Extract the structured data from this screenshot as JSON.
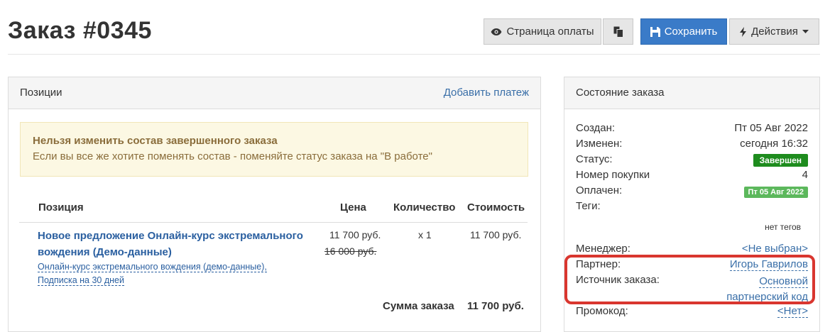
{
  "header": {
    "title": "Заказ #0345",
    "toolbar": {
      "payment_page_label": "Страница оплаты",
      "save_label": "Сохранить",
      "actions_label": "Действия"
    }
  },
  "positions_panel": {
    "title": "Позиции",
    "add_payment_link": "Добавить платеж",
    "alert": {
      "title": "Нельзя изменить состав завершенного заказа",
      "text": "Если вы все же хотите поменять состав - поменяйте статус заказа на \"В работе\""
    },
    "columns": [
      "Позиция",
      "Цена",
      "Количество",
      "Стоимость"
    ],
    "rows": [
      {
        "name_line1": "Новое предложение Онлайн-курс экстремального",
        "name_line2": "вождения (Демо-данные)",
        "sub_line1": "Онлайн-курс экстремального вождения (демо-данные),",
        "sub_line2": "Подписка на 30 дней",
        "price": "11 700 руб.",
        "old_price": "16 000 руб.",
        "quantity": "x 1",
        "cost": "11 700 руб."
      }
    ],
    "total_label": "Сумма заказа",
    "total_value": "11 700 руб."
  },
  "status_panel": {
    "title": "Состояние заказа",
    "created_label": "Создан:",
    "created_value": "Пт 05 Авг 2022",
    "modified_label": "Изменен:",
    "modified_value": "сегодня 16:32",
    "status_label": "Статус:",
    "status_value": "Завершен",
    "purchase_label": "Номер покупки",
    "purchase_value": "4",
    "paid_label": "Оплачен:",
    "paid_value": "Пт 05 Авг 2022",
    "tags_label": "Теги:",
    "tags_value": "нет тегов",
    "manager_label": "Менеджер:",
    "manager_value": "<Не выбран>",
    "partner_label": "Партнер:",
    "partner_value": "Игорь Гаврилов",
    "source_label": "Источник заказа:",
    "source_value_line1": "Основной",
    "source_value_line2": "партнерский код",
    "promo_label": "Промокод:",
    "promo_value": "<Нет>"
  },
  "colors": {
    "primary": "#3a7bc8",
    "link": "#3a6fa8",
    "status_green": "#1e8c1e",
    "paid_green": "#5cb85c",
    "highlight_red": "#d9362f",
    "alert_bg": "#fcf8e3"
  },
  "icons": [
    "eye-icon",
    "copy-icon",
    "save-icon",
    "bolt-icon",
    "caret-down-icon"
  ]
}
